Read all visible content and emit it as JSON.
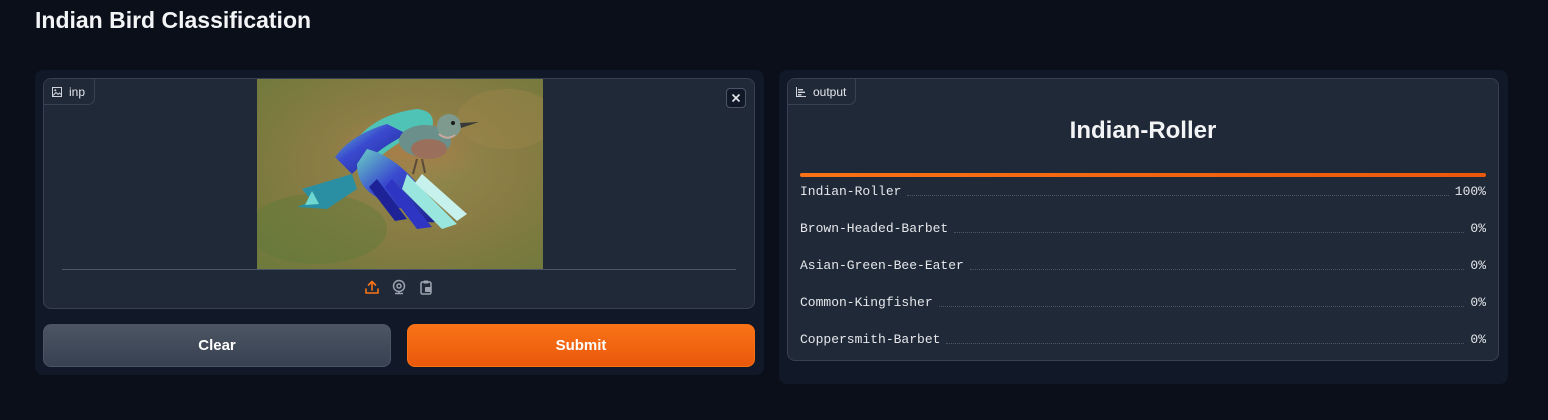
{
  "app": {
    "title": "Indian Bird Classification"
  },
  "input": {
    "label": "inp",
    "label_icon": "image-icon",
    "close_icon": "close-icon",
    "sources": [
      {
        "name": "upload-icon",
        "color": "#f97316"
      },
      {
        "name": "webcam-icon",
        "color": "#9ca3af"
      },
      {
        "name": "clipboard-icon",
        "color": "#9ca3af"
      }
    ]
  },
  "buttons": {
    "clear": "Clear",
    "submit": "Submit"
  },
  "output": {
    "label": "output",
    "label_icon": "bar-chart-icon",
    "top_label": "Indian-Roller",
    "top_confidence": 1.0,
    "confidences": [
      {
        "label": "Indian-Roller",
        "value": "100%"
      },
      {
        "label": "Brown-Headed-Barbet",
        "value": "0%"
      },
      {
        "label": "Asian-Green-Bee-Eater",
        "value": "0%"
      },
      {
        "label": "Common-Kingfisher",
        "value": "0%"
      },
      {
        "label": "Coppersmith-Barbet",
        "value": "0%"
      }
    ]
  },
  "colors": {
    "accent": "#f97316",
    "background": "#0b0f19",
    "panel": "#1f2937"
  }
}
